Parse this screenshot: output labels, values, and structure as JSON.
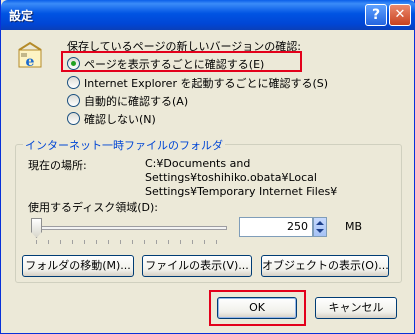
{
  "window": {
    "title": "設定",
    "help_glyph": "?",
    "close_glyph": "✕"
  },
  "update_check": {
    "heading": "保存しているページの新しいバージョンの確認:",
    "options": [
      {
        "label": "ページを表示するごとに確認する(E)",
        "checked": true
      },
      {
        "label": "Internet Explorer を起動するごとに確認する(S)",
        "checked": false
      },
      {
        "label": "自動的に確認する(A)",
        "checked": false
      },
      {
        "label": "確認しない(N)",
        "checked": false
      }
    ]
  },
  "temp_files": {
    "group_title": "インターネット一時ファイルのフォルダ",
    "location_label": "現在の場所:",
    "location_line1": "C:¥Documents and",
    "location_line2": "Settings¥toshihiko.obata¥Local",
    "location_line3": "Settings¥Temporary Internet Files¥",
    "disk_label": "使用するディスク領域(D):",
    "disk_value": "250",
    "disk_unit": "MB",
    "move_folder_button": "フォルダの移動(M)...",
    "view_files_button": "ファイルの表示(V)...",
    "view_objects_button": "オブジェクトの表示(O)..."
  },
  "footer": {
    "ok_button": "OK",
    "cancel_button": "キャンセル"
  },
  "colors": {
    "highlight_box": "#e3001b",
    "titlebar": "#0054e3"
  }
}
